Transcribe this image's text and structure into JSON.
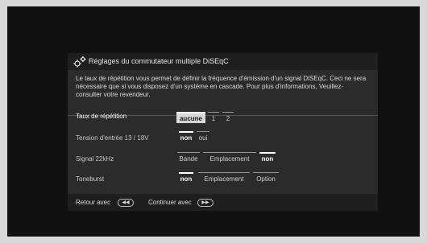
{
  "dialog": {
    "title": "Réglages du commutateur multiple DiSEqC",
    "description": "Le taux de répétition vous permet de définir la fréquence d'émission d'un signal DiSEqC. Ceci ne sera nécessaire que si vous disposez d'un système en cascade. Pour plus d'informations, Veuillez- consulter votre revendeur."
  },
  "rows": [
    {
      "label": "Taux de répétition",
      "options": [
        "aucune",
        "1",
        "2"
      ],
      "selected": "aucune"
    },
    {
      "label": "Tension d'entrée 13 / 18V",
      "options": [
        "non",
        "oui"
      ],
      "selected": "non"
    },
    {
      "label": "Signal 22kHz",
      "options": [
        "Bande",
        "Emplacement",
        "non"
      ],
      "selected": "non"
    },
    {
      "label": "Toneburst",
      "options": [
        "non",
        "Emplacement",
        "Option"
      ],
      "selected": "non"
    }
  ],
  "footer": {
    "back_label": "Retour avec",
    "back_key": "◀◀",
    "continue_label": "Continuer avec",
    "continue_key": "▶▶"
  },
  "icons": {
    "title_icon": "gear-icon",
    "back_key_icon": "rewind-key-icon",
    "continue_key_icon": "forward-key-icon"
  }
}
